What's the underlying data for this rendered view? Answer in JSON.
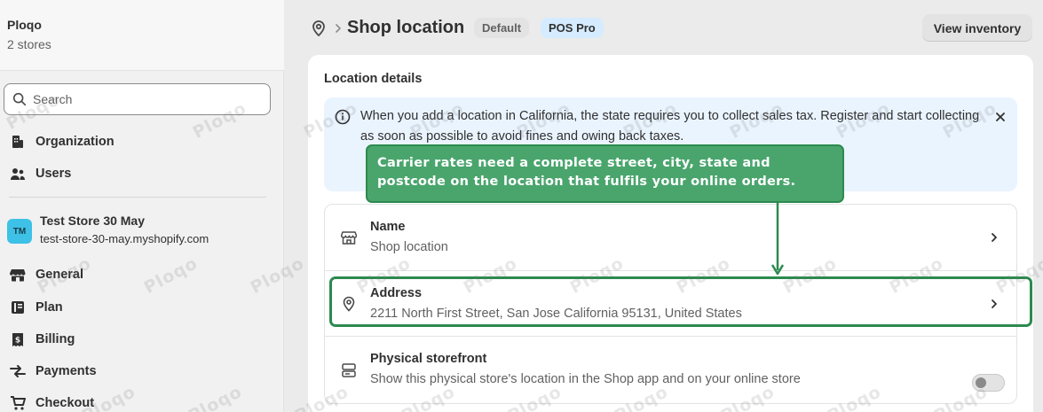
{
  "sidebar": {
    "org_name": "Ploqo",
    "store_count": "2 stores",
    "search": {
      "placeholder": "Search"
    },
    "items": [
      {
        "label": "Organization",
        "icon": "building-icon"
      },
      {
        "label": "Users",
        "icon": "users-icon"
      },
      {
        "label": "General",
        "icon": "store-icon"
      },
      {
        "label": "Plan",
        "icon": "plan-icon"
      },
      {
        "label": "Billing",
        "icon": "billing-icon"
      },
      {
        "label": "Payments",
        "icon": "payments-icon"
      },
      {
        "label": "Checkout",
        "icon": "cart-icon"
      }
    ],
    "store": {
      "initials": "TM",
      "name": "Test Store 30 May",
      "url": "test-store-30-may.myshopify.com"
    }
  },
  "header": {
    "title": "Shop location",
    "badges": [
      "Default",
      "POS Pro"
    ],
    "view_inventory": "View inventory"
  },
  "card": {
    "title": "Location details",
    "banner": {
      "text": "When you add a location in California, the state requires you to collect sales tax. Register and start collecting as soon as possible to avoid fines and owing back taxes."
    },
    "rows": [
      {
        "label": "Name",
        "value": "Shop location",
        "icon": "store-icon"
      },
      {
        "label": "Address",
        "value": "2211 North First Street, San Jose California 95131, United States",
        "icon": "location-pin-icon"
      },
      {
        "label": "Physical storefront",
        "value": "Show this physical store's location in the Shop app and on your online store",
        "icon": "storefront-icon",
        "toggle_on": false
      }
    ]
  },
  "annotation": {
    "text": "Carrier rates need a complete street, city, state and postcode on the location that fulfils your online orders.",
    "color": "#4aa56d"
  },
  "watermark": "Ploqo"
}
